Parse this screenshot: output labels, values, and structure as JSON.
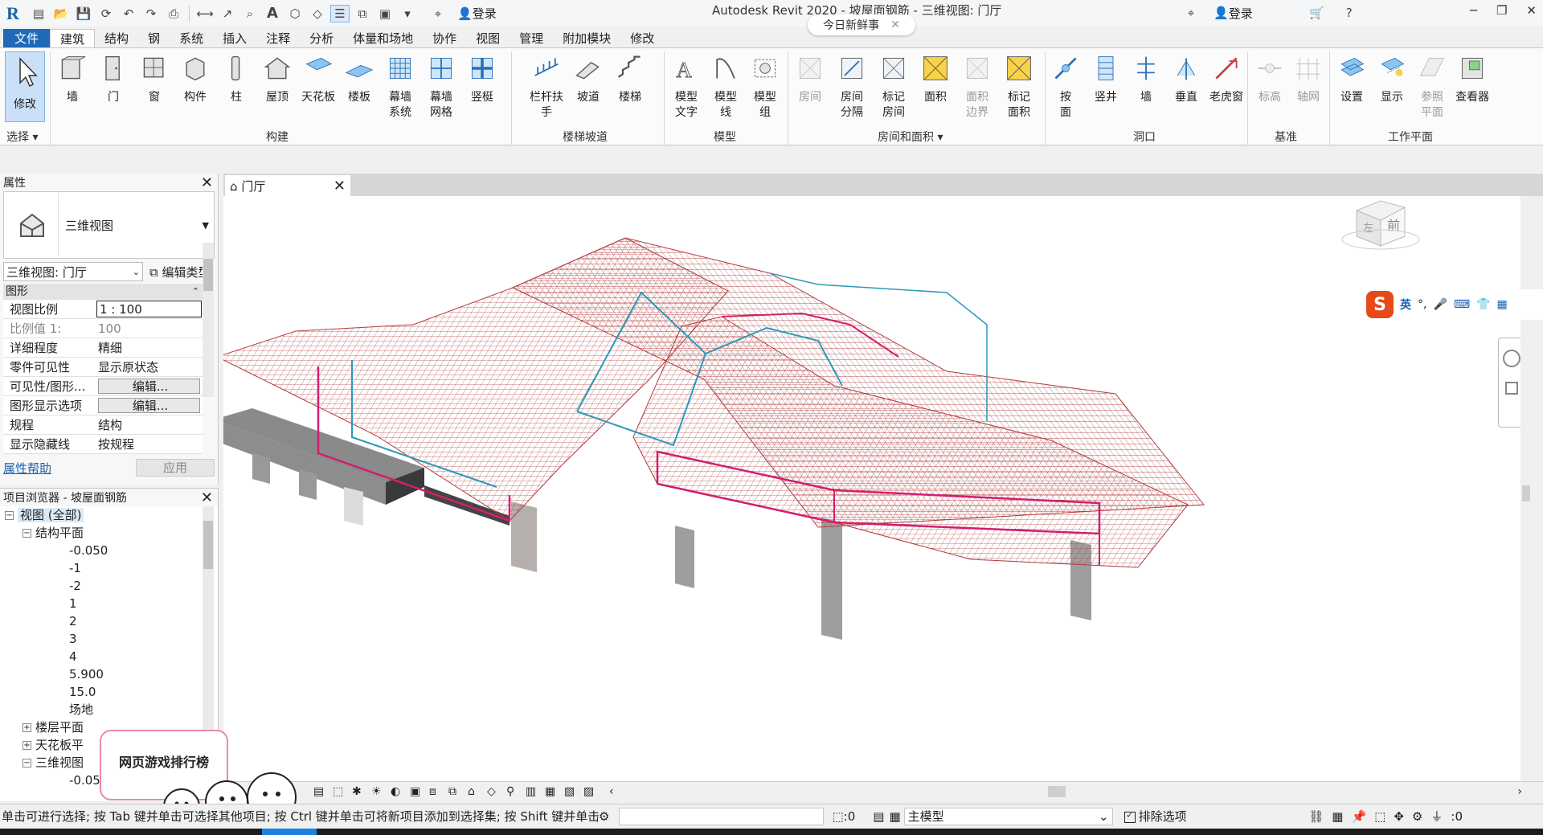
{
  "app": {
    "title": "Autodesk Revit 2020 - 坡屋面钢筋 - 三维视图: 门厅",
    "login_label": "登录",
    "login_label_right": "登录",
    "news_label": "今日新鲜事"
  },
  "tabs": [
    "文件",
    "建筑",
    "结构",
    "钢",
    "系统",
    "插入",
    "注释",
    "分析",
    "体量和场地",
    "协作",
    "视图",
    "管理",
    "附加模块",
    "修改"
  ],
  "ribbon": {
    "modify": "修改",
    "select": "选择",
    "build": [
      {
        "label": "墙",
        "name": "wall"
      },
      {
        "label": "门",
        "name": "door"
      },
      {
        "label": "窗",
        "name": "window"
      },
      {
        "label": "构件",
        "name": "component"
      },
      {
        "label": "柱",
        "name": "column"
      },
      {
        "label": "屋顶",
        "name": "roof"
      },
      {
        "label": "天花板",
        "name": "ceiling"
      },
      {
        "label": "楼板",
        "name": "floor"
      },
      {
        "label": "幕墙\n系统",
        "name": "curtain-system"
      },
      {
        "label": "幕墙\n网格",
        "name": "curtain-grid"
      },
      {
        "label": "竖梃",
        "name": "mullion"
      }
    ],
    "circulation": [
      {
        "label": "栏杆扶手",
        "name": "railing"
      },
      {
        "label": "坡道",
        "name": "ramp"
      },
      {
        "label": "楼梯",
        "name": "stair"
      }
    ],
    "model": [
      {
        "label": "模型\n文字",
        "name": "model-text"
      },
      {
        "label": "模型\n线",
        "name": "model-line"
      },
      {
        "label": "模型\n组",
        "name": "model-group"
      }
    ],
    "room": [
      {
        "label": "房间",
        "name": "room",
        "dim": true
      },
      {
        "label": "房间\n分隔",
        "name": "room-separator",
        "dim": false
      },
      {
        "label": "标记\n房间",
        "name": "tag-room",
        "dim": false
      },
      {
        "label": "面积",
        "name": "area",
        "dim": false
      },
      {
        "label": "面积\n边界",
        "name": "area-boundary",
        "dim": true
      },
      {
        "label": "标记\n面积",
        "name": "tag-area",
        "dim": false
      }
    ],
    "opening": [
      {
        "label": "按\n面",
        "name": "by-face"
      },
      {
        "label": "竖井",
        "name": "shaft"
      },
      {
        "label": "墙",
        "name": "wall-opening"
      },
      {
        "label": "垂直",
        "name": "vertical"
      },
      {
        "label": "老虎窗",
        "name": "dormer"
      }
    ],
    "datum": [
      {
        "label": "标高",
        "name": "level",
        "dim": true
      },
      {
        "label": "轴网",
        "name": "grid",
        "dim": true
      }
    ],
    "workplane": [
      {
        "label": "设置",
        "name": "set",
        "dim": false
      },
      {
        "label": "显示",
        "name": "show",
        "dim": false
      },
      {
        "label": "参照\n平面",
        "name": "ref-plane",
        "dim": true
      },
      {
        "label": "查看器",
        "name": "viewer",
        "dim": false
      }
    ],
    "groups": {
      "build": "构建",
      "circulation": "楼梯坡道",
      "model": "模型",
      "room": "房间和面积",
      "opening": "洞口",
      "datum": "基准",
      "workplane": "工作平面"
    }
  },
  "properties": {
    "title": "属性",
    "type_name": "三维视图",
    "selector": "三维视图: 门厅",
    "edit_type": "编辑类型",
    "category": "图形",
    "rows": [
      {
        "k": "视图比例",
        "v": "1 : 100",
        "style": "boxed"
      },
      {
        "k": "比例值 1:",
        "v": "100",
        "style": "gray"
      },
      {
        "k": "详细程度",
        "v": "精细",
        "style": ""
      },
      {
        "k": "零件可见性",
        "v": "显示原状态",
        "style": ""
      },
      {
        "k": "可见性/图形...",
        "v": "编辑...",
        "style": "btn"
      },
      {
        "k": "图形显示选项",
        "v": "编辑...",
        "style": "btn"
      },
      {
        "k": "规程",
        "v": "结构",
        "style": ""
      },
      {
        "k": "显示隐藏线",
        "v": "按规程",
        "style": ""
      }
    ],
    "help": "属性帮助",
    "apply": "应用"
  },
  "browser": {
    "title": "项目浏览器 - 坡屋面钢筋",
    "root": "视图 (全部)",
    "structural_plans": "结构平面",
    "plans": [
      "-0.050",
      "-1",
      "-2",
      "1",
      "2",
      "3",
      "4",
      "5.900",
      "15.0",
      "场地"
    ],
    "floor_plans": "楼层平面",
    "ceiling_plans": "天花板平",
    "views3d": "三维视图",
    "views3d_first": "-0.05"
  },
  "view": {
    "tab_title": "门厅",
    "cube_front": "前",
    "cube_left": "左"
  },
  "ime": {
    "s": "S",
    "lang": "英"
  },
  "ad": {
    "text": "网页游戏排行榜"
  },
  "status": {
    "message": "单击可进行选择; 按 Tab 键并单击可选择其他项目; 按 Ctrl 键并单击可将新项目添加到选择集; 按 Shift 键并单击可",
    "count1": ":0",
    "model": "主模型",
    "exclude": "排除选项",
    "filter": ":0"
  },
  "colors": {
    "accent": "#1e6ab8",
    "roof_lines": "#b33a3a",
    "rebar_magenta": "#d21e6e",
    "rebar_cyan": "#2a9ab8",
    "column": "#a0a0a0"
  }
}
